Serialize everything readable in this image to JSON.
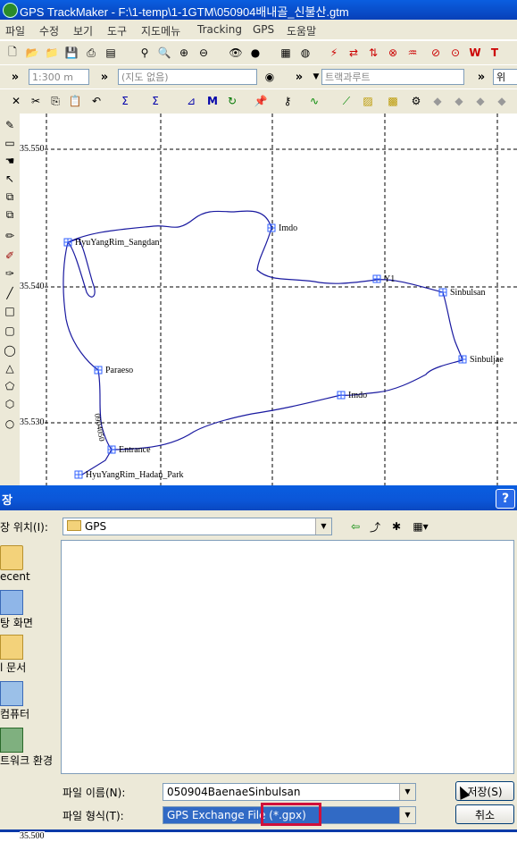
{
  "window": {
    "title": "GPS TrackMaker - F:\\1-temp\\1-1GTM\\050904배내골_신불산.gtm"
  },
  "menu": [
    "파일",
    "수정",
    "보기",
    "도구",
    "지도메뉴",
    "Tracking",
    "GPS",
    "도움말"
  ],
  "toolbar2": {
    "scale": "1:300 m",
    "map_combo": "(지도 없음)",
    "track_combo": "트랙과루트",
    "right_label": "위"
  },
  "map": {
    "grid_labels": [
      "35.550",
      "35.540",
      "35.530",
      "35.500"
    ],
    "track_label": "0904050",
    "waypoints": [
      "HyuYangRim_Sangdan",
      "Imdo",
      "Y1",
      "Sinbulsan",
      "Sinbuljae",
      "Imdo",
      "Paraeso",
      "Entrance",
      "HyuYangRim_Hadan_Park"
    ],
    "track_color": "#1a1aa0",
    "waypoint_color": "#3060ff"
  },
  "dialog": {
    "title": "장",
    "save_in_label": "장 위치(I):",
    "save_in_value": "GPS",
    "places": [
      "ecent",
      "탕 화면",
      "l 문서",
      "컴퓨터",
      "트워크 환경"
    ],
    "filename_label": "파일 이름(N):",
    "filename_value": "050904BaenaeSinbulsan",
    "filetype_label": "파일 형식(T):",
    "filetype_value": "GPS Exchange File (*.gpx)",
    "save_button": "저장(S)",
    "cancel_button": "취소",
    "highlight_color": "#d0103a"
  }
}
